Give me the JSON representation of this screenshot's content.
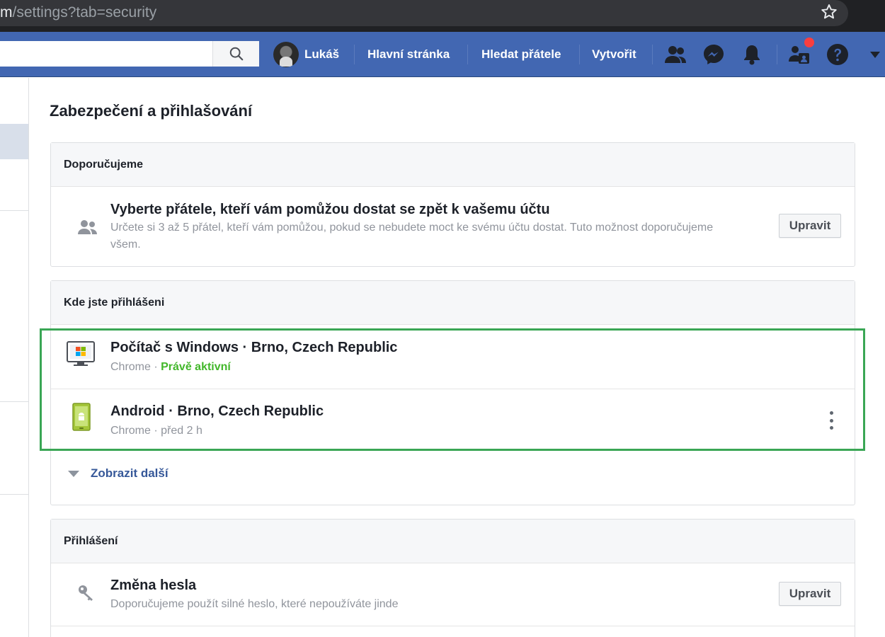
{
  "browser": {
    "url_host": "m",
    "url_path": "/settings?tab=security"
  },
  "topbar": {
    "search_placeholder": "",
    "profile_name": "Lukáš",
    "nav_links": [
      "Hlavní stránka",
      "Hledat přátele",
      "Vytvořit"
    ],
    "brand_color": "#4267b2",
    "notification_dot_color": "#fa3e3e"
  },
  "page": {
    "title": "Zabezpečení a přihlašování"
  },
  "recommended": {
    "header": "Doporučujeme",
    "item": {
      "title": "Vyberte přátele, kteří vám pomůžou dostat se zpět k vašemu účtu",
      "description": "Určete si 3 až 5 přátel, kteří vám pomůžou, pokud se nebudete moct ke svému účtu dostat. Tuto možnost doporučujeme všem.",
      "button": "Upravit",
      "icon": "friends-icon"
    }
  },
  "sessions": {
    "header": "Kde jste přihlášeni",
    "items": [
      {
        "title": "Počítač s Windows · Brno, Czech Republic",
        "browser": "Chrome",
        "separator": " · ",
        "status": "Právě aktivní",
        "icon": "windows-computer-icon"
      },
      {
        "title": "Android · Brno, Czech Republic",
        "browser": "Chrome",
        "separator": " · ",
        "status": "před 2 h",
        "icon": "android-phone-icon"
      }
    ],
    "show_more": "Zobrazit další",
    "highlight_color": "#3aa655",
    "active_color": "#42b72a"
  },
  "login": {
    "header": "Přihlášení",
    "item": {
      "title": "Změna hesla",
      "description": "Doporučujeme použít silné heslo, které nepoužíváte jinde",
      "button": "Upravit",
      "icon": "key-icon"
    }
  }
}
